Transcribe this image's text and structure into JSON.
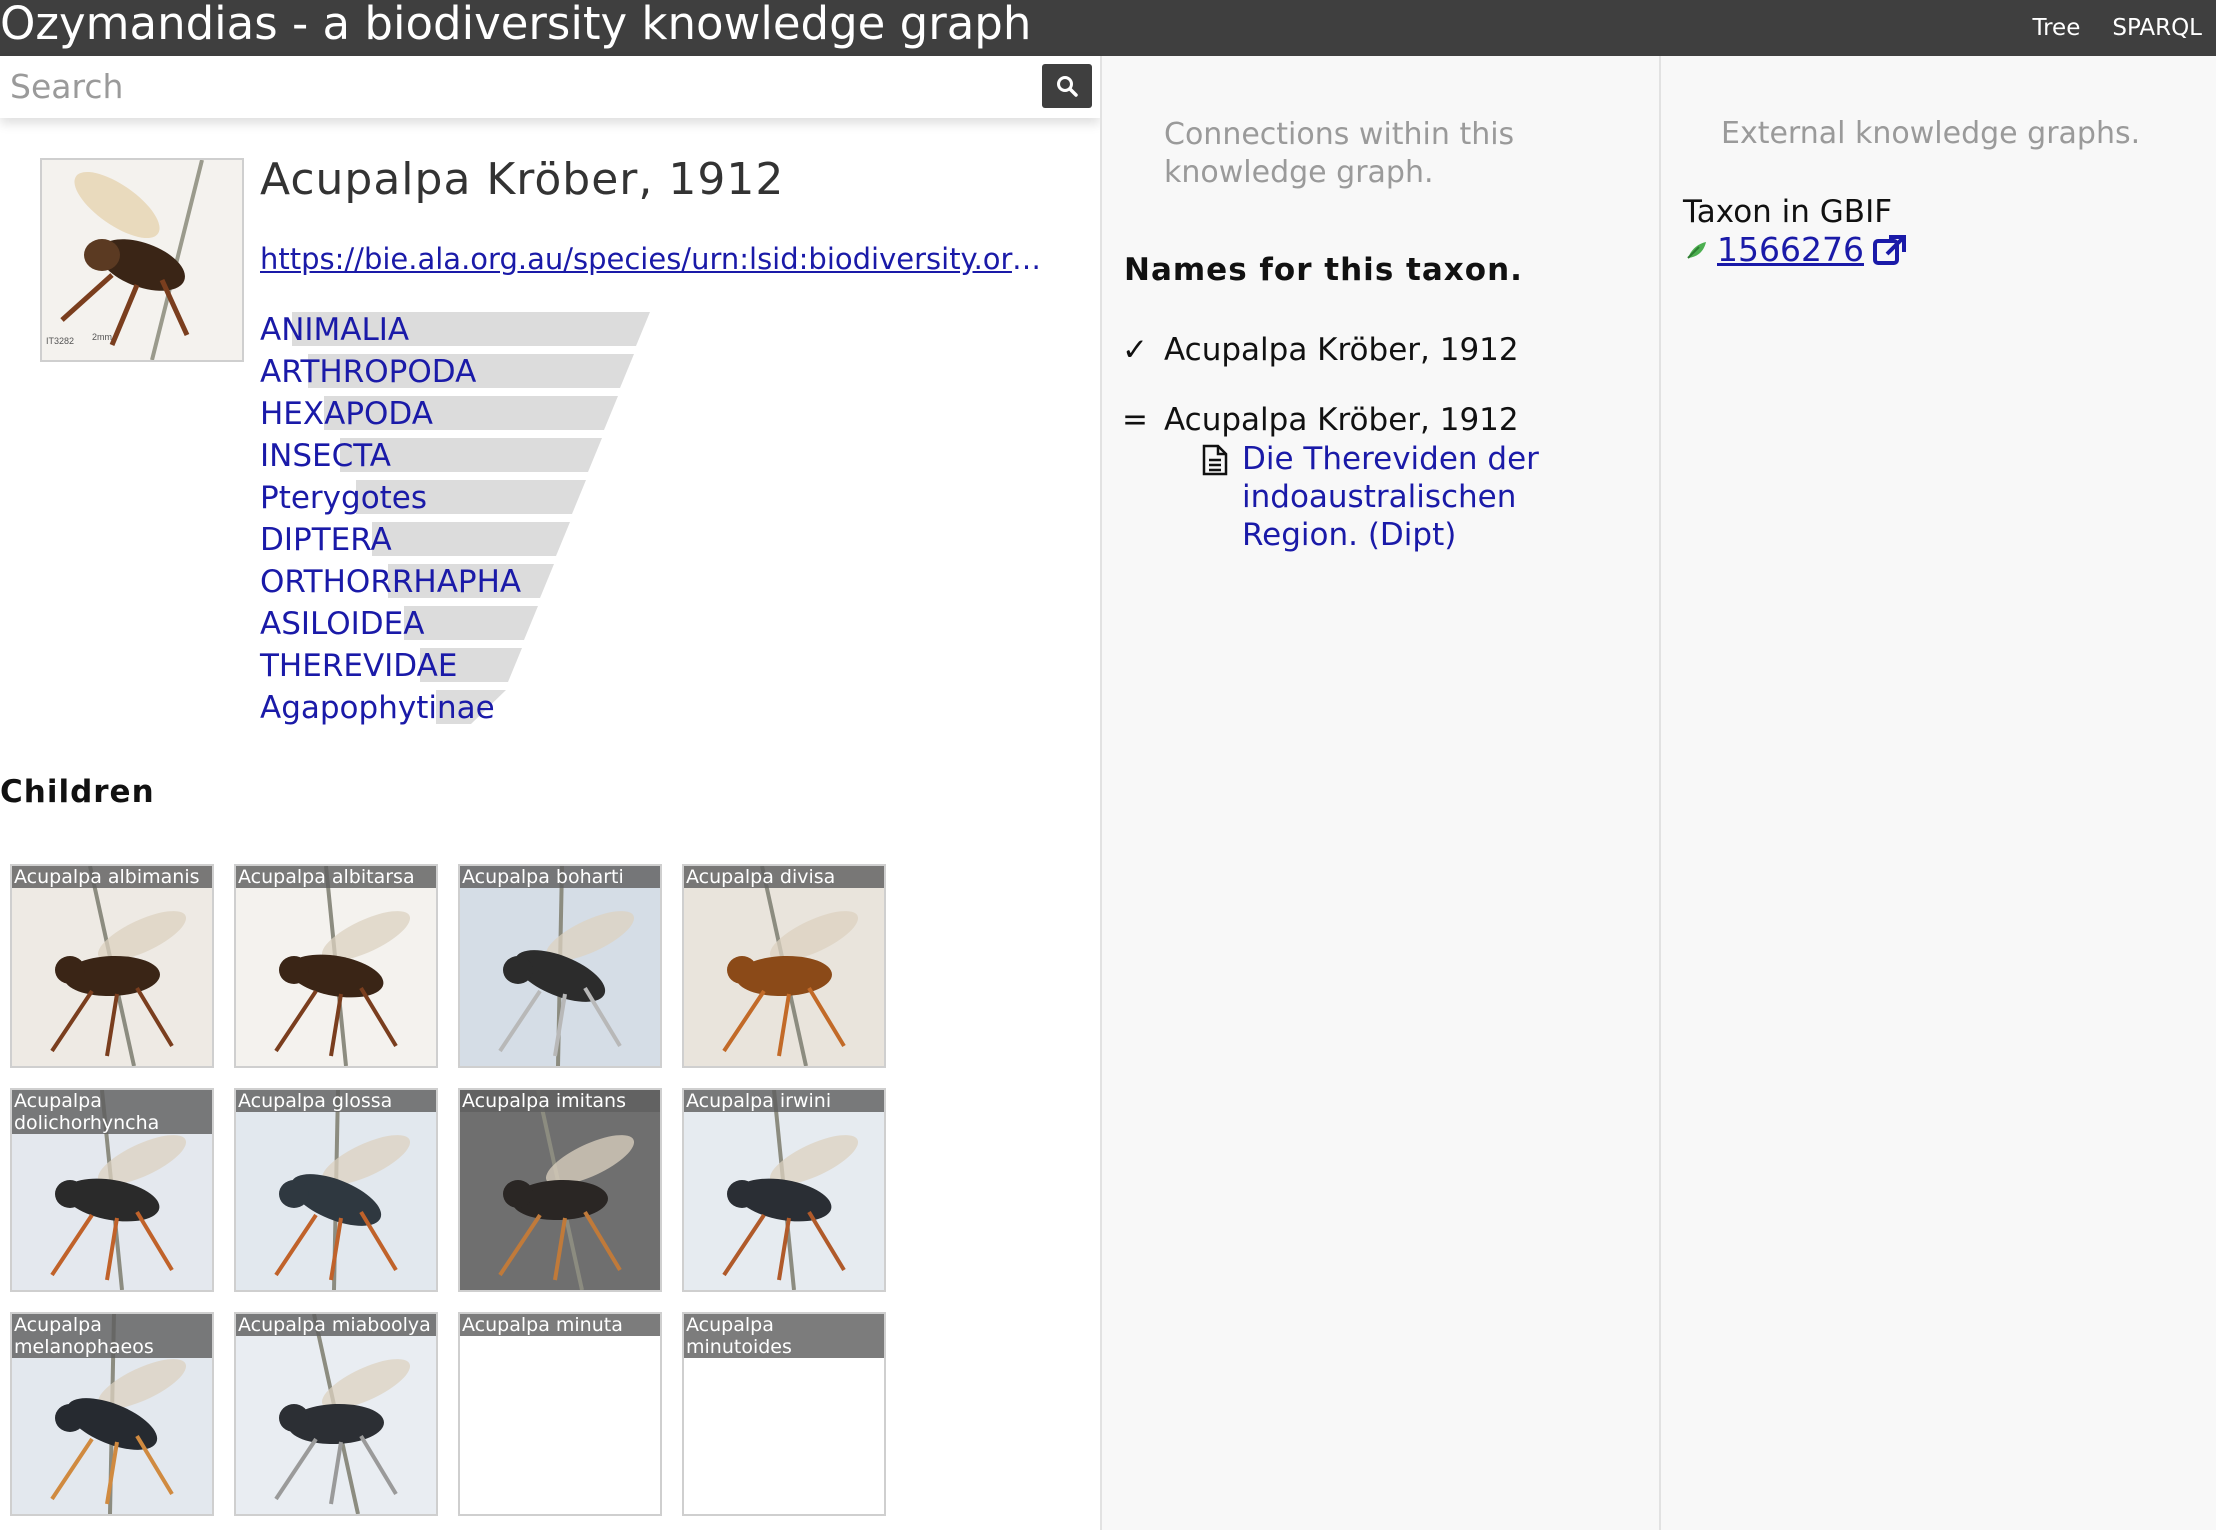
{
  "app": {
    "title": "Ozymandias - a biodiversity knowledge graph",
    "nav": [
      "Tree",
      "SPARQL"
    ]
  },
  "search": {
    "placeholder": "Search"
  },
  "taxon": {
    "name": "Acupalpa Kröber, 1912",
    "url": "https://bie.ala.org.au/species/urn:lsid:biodiversity.org.au:afd.taxon:"
  },
  "lineage": [
    "ANIMALIA",
    "ARTHROPODA",
    "HEXAPODA",
    "INSECTA",
    "Pterygotes",
    "DIPTERA",
    "ORTHORRHAPHA",
    "ASILOIDEA",
    "THEREVIDAE",
    "Agapophytinae"
  ],
  "children": {
    "heading": "Children",
    "items": [
      {
        "name": "Acupalpa albimanis",
        "has_image": true
      },
      {
        "name": "Acupalpa albitarsa",
        "has_image": true
      },
      {
        "name": "Acupalpa boharti",
        "has_image": true
      },
      {
        "name": "Acupalpa divisa",
        "has_image": true
      },
      {
        "name": "Acupalpa dolichorhyncha",
        "has_image": true
      },
      {
        "name": "Acupalpa glossa",
        "has_image": true
      },
      {
        "name": "Acupalpa imitans",
        "has_image": true
      },
      {
        "name": "Acupalpa irwini",
        "has_image": true
      },
      {
        "name": "Acupalpa melanophaeos",
        "has_image": true
      },
      {
        "name": "Acupalpa miaboolya",
        "has_image": true
      },
      {
        "name": "Acupalpa minuta",
        "has_image": false
      },
      {
        "name": "Acupalpa minutoides",
        "has_image": false
      }
    ]
  },
  "connections": {
    "intro": "Connections within this knowledge graph.",
    "names_heading": "Names for this taxon.",
    "accepted": {
      "marker": "✓",
      "name": "Acupalpa Kröber, 1912"
    },
    "synonym": {
      "marker": "=",
      "name": "Acupalpa Kröber, 1912",
      "publication": "Die Thereviden der indoaustralischen Region. (Dipt)"
    }
  },
  "external": {
    "intro": "External knowledge graphs.",
    "gbif_label": "Taxon in GBIF",
    "gbif_id": "1566276"
  },
  "colors": {
    "topbar": "#3f3f3f",
    "link": "#1a1aa8",
    "muted": "#9a9a9a",
    "lineage_bar": "#dcdcdc",
    "gbif_leaf": "#4caf50"
  }
}
